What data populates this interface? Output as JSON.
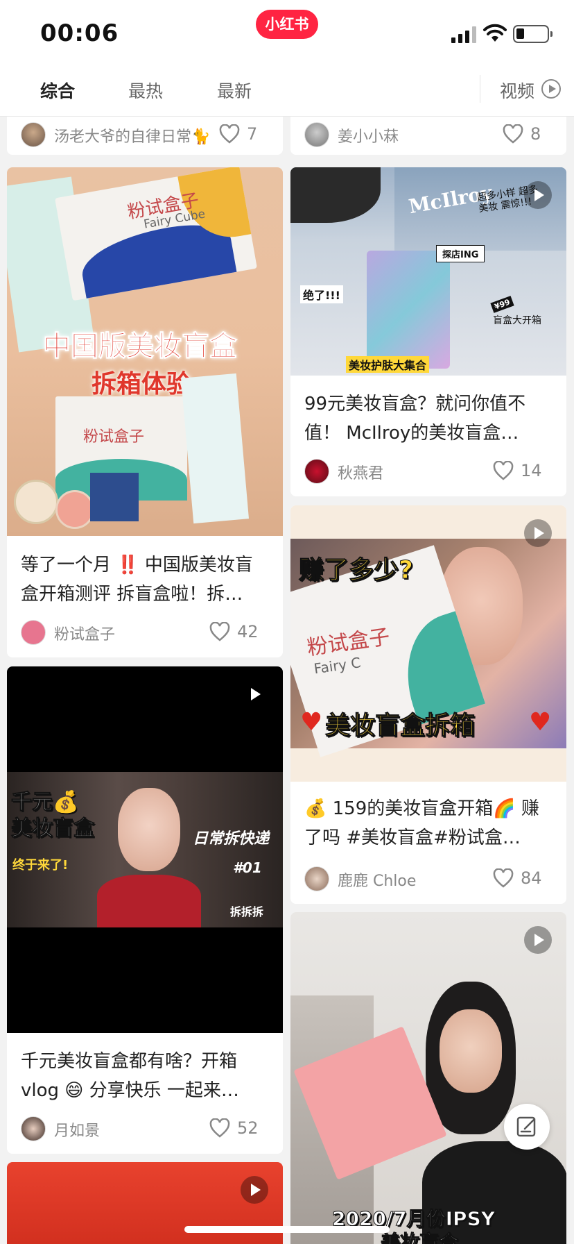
{
  "status_bar": {
    "time": "00:06",
    "app_badge": "小红书"
  },
  "tabs": {
    "items": [
      "综合",
      "最热",
      "最新"
    ],
    "active": "综合",
    "video_label": "视频"
  },
  "top_partial": {
    "left": {
      "author": "汤老大爷的自律日常🐈",
      "likes": "7"
    },
    "right": {
      "author": "姜小小菻",
      "likes": "8"
    }
  },
  "cards": {
    "fairy_cube": {
      "title": "等了一个月 ‼️ 中国版美妆盲盒开箱测评 拆盲盒啦！拆…",
      "author": "粉试盒子",
      "likes": "42",
      "overlay_line1": "中国版美妆盲盒",
      "overlay_line2": "拆箱体验",
      "box_brand": "粉试盒子",
      "box_brand_en": "Fairy Cube"
    },
    "mcllroy": {
      "title": "99元美妆盲盒？就问你值不值！ McIlroy的美妆盲盒…",
      "author": "秋燕君",
      "likes": "14",
      "overlay_store": "McIlroy",
      "overlay_tag": "探店ING",
      "overlay_wow": "绝了!!!",
      "overlay_note": "超多小样 超多美妆 震惊!!!",
      "overlay_open": "盲盒大开箱",
      "overlay_price": "¥99",
      "overlay_bottom": "美妆护肤大集合"
    },
    "earned": {
      "title": "💰 159的美妆盲盒开箱🌈 赚了吗 #美妆盲盒#粉试盒…",
      "author": "鹿鹿 Chloe",
      "likes": "84",
      "overlay_top": "赚了多少?",
      "overlay_bottom": "美妆盲盒拆箱",
      "box_brand": "粉试盒子",
      "box_brand_en": "Fairy C"
    },
    "thousand": {
      "title": "千元美妆盲盒都有啥？开箱vlog 😄 分享快乐 一起来…",
      "author": "月如景",
      "likes": "52",
      "overlay_left1": "千元💰",
      "overlay_left2": "美妆盲盒",
      "overlay_left3": "终于来了!",
      "overlay_right1": "日常拆快递",
      "overlay_right2": "#01",
      "overlay_right3": "拆拆拆"
    },
    "ipsy": {
      "overlay_line1": "2020/7月份IPSY",
      "overlay_line2": "美妆盲合"
    }
  },
  "colors": {
    "brand": "#ff2442",
    "heart": "#888888"
  }
}
